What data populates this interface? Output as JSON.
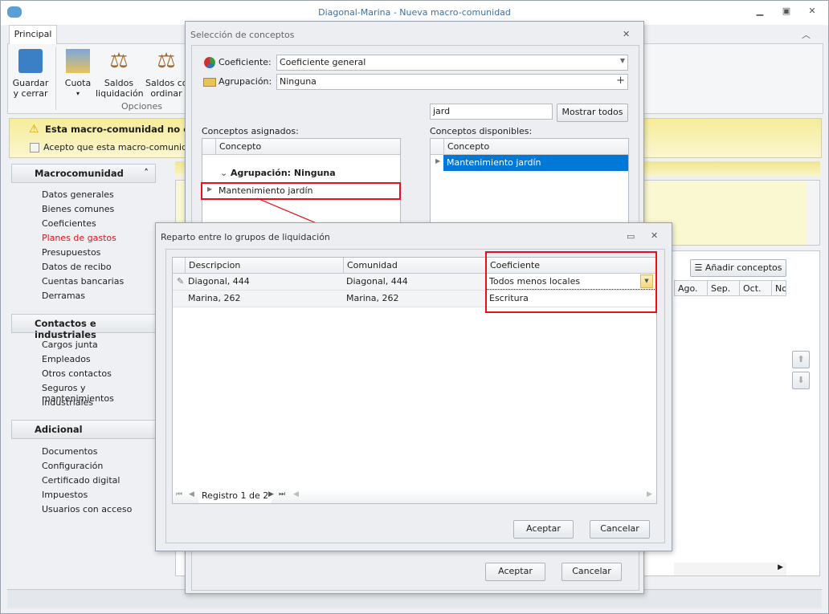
{
  "window": {
    "title": "Diagonal-Marina - Nueva macro-comunidad"
  },
  "ribbon": {
    "tab": "Principal",
    "buttons": [
      {
        "label1": "Guardar",
        "label2": "y cerrar"
      },
      {
        "label1": "Cuota",
        "label2": "▾"
      },
      {
        "label1": "Saldos",
        "label2": "liquidación"
      },
      {
        "label1": "Saldos con",
        "label2": "ordinar"
      }
    ],
    "group": "Opciones"
  },
  "warning": {
    "text": "Esta macro-comunidad no está",
    "checkbox": "Acepto que esta macro-comunidad es"
  },
  "sidebar": {
    "groups": [
      {
        "title": "Macrocomunidad",
        "items": [
          "Datos generales",
          "Bienes comunes",
          "Coeficientes",
          "Planes de gastos",
          "Presupuestos",
          "Datos de recibo",
          "Cuentas bancarias",
          "Derramas"
        ]
      },
      {
        "title": "Contactos e industriales",
        "items": [
          "Cargos junta",
          "Empleados",
          "Otros contactos",
          "Seguros y mantenimientos",
          "Industriales"
        ]
      },
      {
        "title": "Adicional",
        "items": [
          "Documentos",
          "Configuración",
          "Certificado digital",
          "Impuestos",
          "Usuarios con acceso"
        ]
      }
    ],
    "active_item": "Planes de gastos",
    "active_color": "#e8101a"
  },
  "content": {
    "add_button": "Añadir conceptos",
    "months": [
      "Ago.",
      "Sep.",
      "Oct.",
      "Nov"
    ]
  },
  "dialog1": {
    "title": "Selección de conceptos",
    "coef_label": "Coeficiente:",
    "coef_value": "Coeficiente general",
    "agrup_label": "Agrupación:",
    "agrup_value": "Ninguna",
    "search_value": "jard",
    "show_all": "Mostrar todos",
    "assigned_label": "Conceptos asignados:",
    "available_label": "Conceptos disponibles:",
    "col": "Concepto",
    "group_row": "Agrupación: Ninguna",
    "assigned_rows": [
      "Mantenimiento jardín"
    ],
    "available_rows": [
      "Mantenimiento jardín"
    ],
    "ok": "Aceptar",
    "cancel": "Cancelar"
  },
  "dialog2": {
    "title": "Reparto entre lo grupos de liquidación",
    "columns": [
      "Descripcion",
      "Comunidad",
      "Coeficiente"
    ],
    "rows": [
      [
        "Diagonal, 444",
        "Diagonal, 444",
        "Todos menos locales"
      ],
      [
        "Marina, 262",
        "Marina, 262",
        "Escritura"
      ]
    ],
    "nav": "Registro 1 de 2",
    "ok": "Aceptar",
    "cancel": "Cancelar"
  },
  "colors": {
    "selection": "#0078d7",
    "highlight": "#e8101a",
    "warning_bg": "#f6ec9a"
  }
}
